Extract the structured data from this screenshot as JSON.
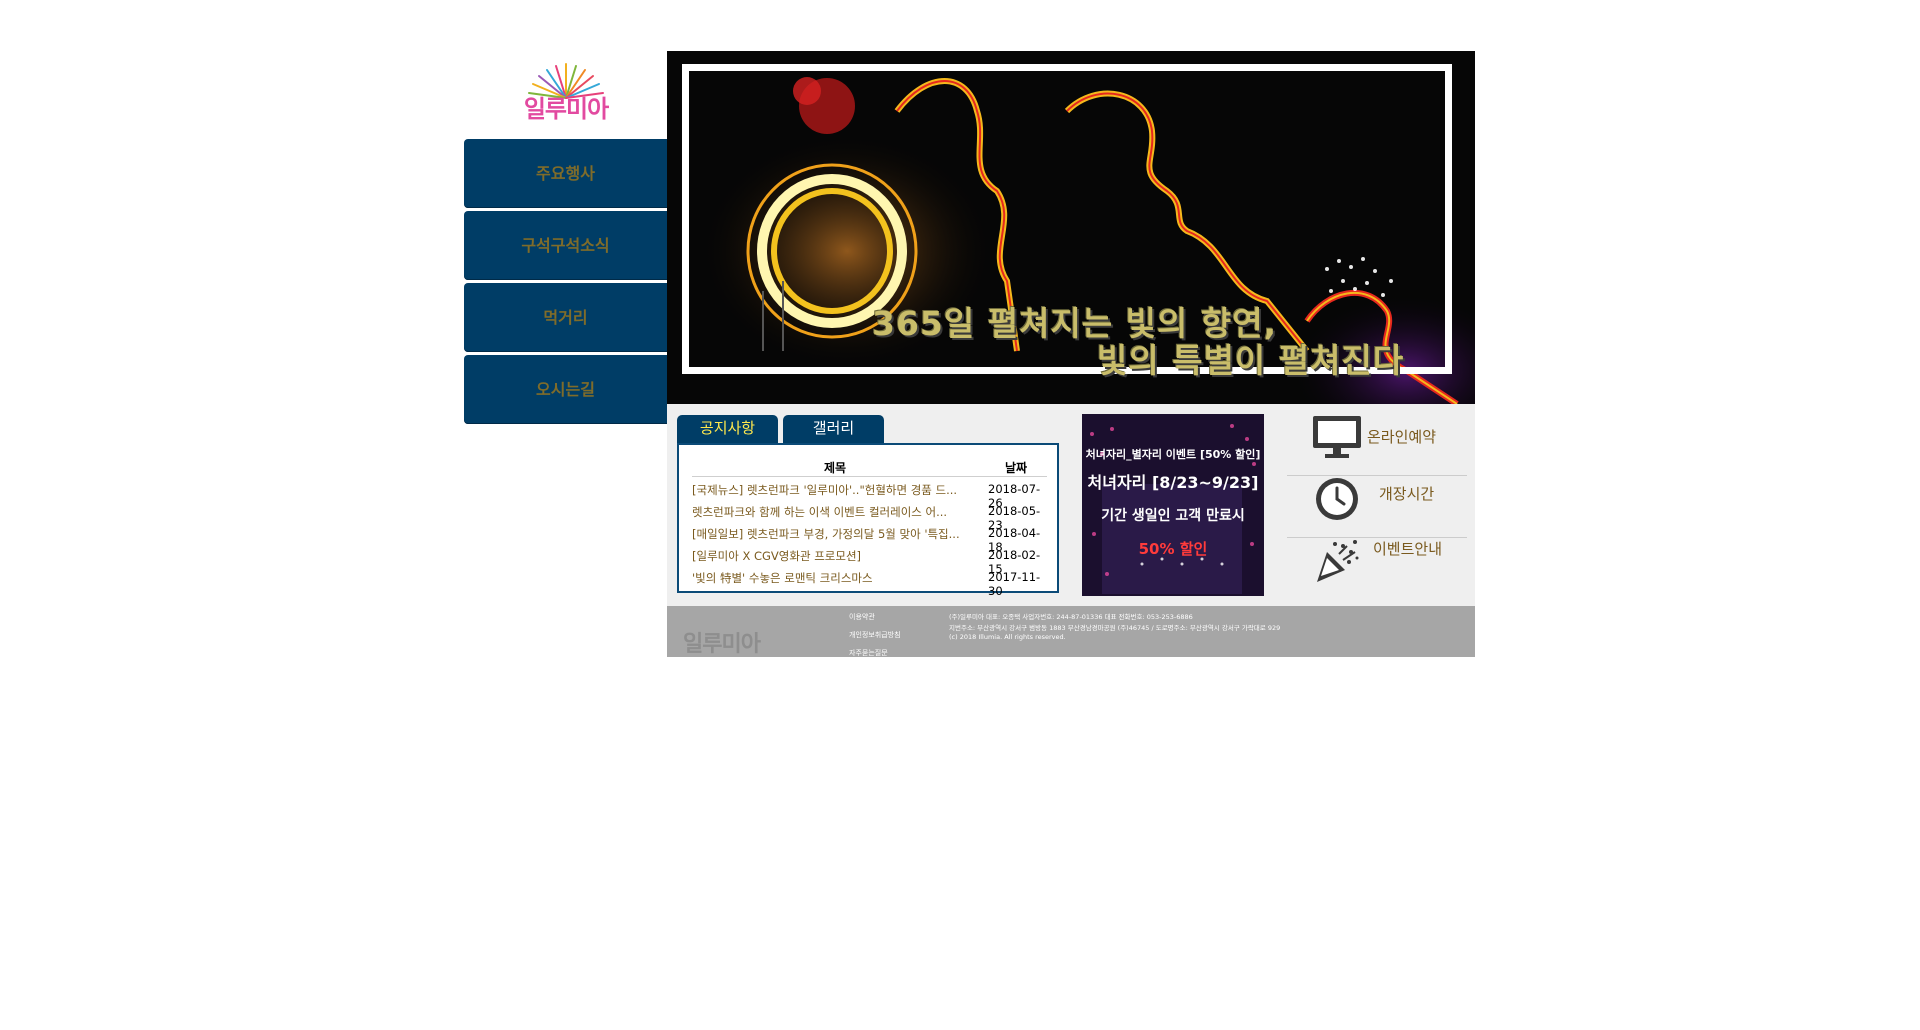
{
  "logo": {
    "text": "일루미아"
  },
  "nav": {
    "items": [
      {
        "label": "주요행사"
      },
      {
        "label": "구석구석소식"
      },
      {
        "label": "먹거리"
      },
      {
        "label": "오시는길"
      }
    ]
  },
  "hero": {
    "line1": "365일 펼쳐지는 빛의 향연,",
    "line2": "빛의 특별이 펼쳐진다"
  },
  "tabs": [
    {
      "label": "공지사항",
      "active": true
    },
    {
      "label": "갤러리",
      "active": false
    }
  ],
  "board": {
    "header_title": "제목",
    "header_date": "날짜",
    "rows": [
      {
        "title": "[국제뉴스] 렛츠런파크 '일루미아'..\"헌혈하면 경품 드...",
        "date": "2018-07-26"
      },
      {
        "title": "렛츠런파크와 함께 하는 이색 이벤트 컬러레이스 어...",
        "date": "2018-05-23"
      },
      {
        "title": "[매일일보] 렛츠런파크 부경, 가정의달 5월 맞아 '특집...",
        "date": "2018-04-18"
      },
      {
        "title": "[일루미아 X CGV영화관 프로모션]",
        "date": "2018-02-15"
      },
      {
        "title": "'빛의 特별' 수놓은 로맨틱 크리스마스",
        "date": "2017-11-30"
      }
    ]
  },
  "event_banner": {
    "title": "처녀자리_별자리 이벤트 [50% 할인]",
    "dates": "처녀자리 [8/23~9/23]",
    "subtitle": "기간 생일인 고객 만료시",
    "discount": "50% 할인"
  },
  "quick_links": [
    {
      "label": "온라인예약",
      "icon": "monitor-icon"
    },
    {
      "label": "개장시간",
      "icon": "clock-icon"
    },
    {
      "label": "이벤트안내",
      "icon": "party-popper-icon"
    }
  ],
  "footer": {
    "logo_text": "일루미아",
    "links": [
      {
        "label": "이용약관"
      },
      {
        "label": "개인정보취급방침"
      },
      {
        "label": "자주묻는질문"
      }
    ],
    "info": [
      "(주)일루미아 대표: 오종택 사업자번호: 244-87-01336 대표 전화번호: 053-253-6886",
      "지번주소: 부산광역시 강서구 범방동 1883 부산경남경마공원 (주)46745 / 도로명주소: 부산광역시 강서구 가락대로 929",
      "(c) 2018 Illumia. All rights reserved."
    ]
  },
  "colors": {
    "nav_bg": "#003d66",
    "nav_text": "#7f6c2a",
    "tab_active_text": "#ffe84d",
    "board_border": "#0b4a77",
    "footer_bg": "#a6a6a6"
  }
}
